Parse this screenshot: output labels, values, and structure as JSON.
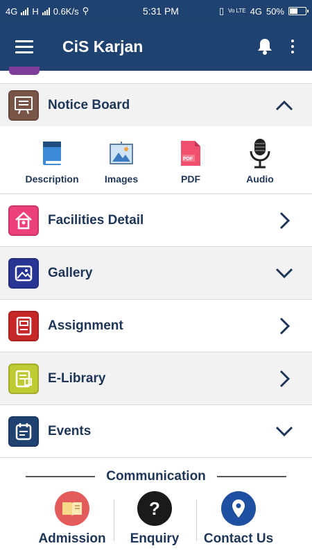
{
  "status_bar": {
    "network_1": "4G",
    "network_2": "H",
    "speed": "0.6K/s",
    "time": "5:31 PM",
    "volte": "Vo LTE",
    "network_3": "4G",
    "battery": "50%"
  },
  "app_bar": {
    "title": "CiS Karjan"
  },
  "menu": {
    "notice_board": {
      "label": "Notice Board",
      "tile_color": "#795548",
      "expanded": true,
      "sub_items": [
        {
          "label": "Description",
          "icon": "book-icon"
        },
        {
          "label": "Images",
          "icon": "picture-icon"
        },
        {
          "label": "PDF",
          "icon": "pdf-icon"
        },
        {
          "label": "Audio",
          "icon": "microphone-icon"
        }
      ]
    },
    "facilities": {
      "label": "Facilities Detail",
      "tile_color": "#ec407a",
      "icon": "birdhouse-icon"
    },
    "gallery": {
      "label": "Gallery",
      "tile_color": "#283593",
      "icon": "image-icon"
    },
    "assignment": {
      "label": "Assignment",
      "tile_color": "#c62828",
      "icon": "notebook-icon"
    },
    "elibrary": {
      "label": "E-Library",
      "tile_color": "#c0ca33",
      "icon": "library-icon"
    },
    "events": {
      "label": "Events",
      "tile_color": "#1f4270",
      "icon": "calendar-icon"
    }
  },
  "communication": {
    "title": "Communication",
    "items": [
      {
        "label": "Admission",
        "icon": "book-open-icon",
        "color": "#e35b5b"
      },
      {
        "label": "Enquiry",
        "icon": "question-icon",
        "color": "#1a1a1a"
      },
      {
        "label": "Contact Us",
        "icon": "location-pin-icon",
        "color": "#1f4fa0"
      }
    ]
  },
  "colors": {
    "primary": "#1f4270",
    "text": "#1d3557",
    "row_grey": "#f2f2f2"
  }
}
